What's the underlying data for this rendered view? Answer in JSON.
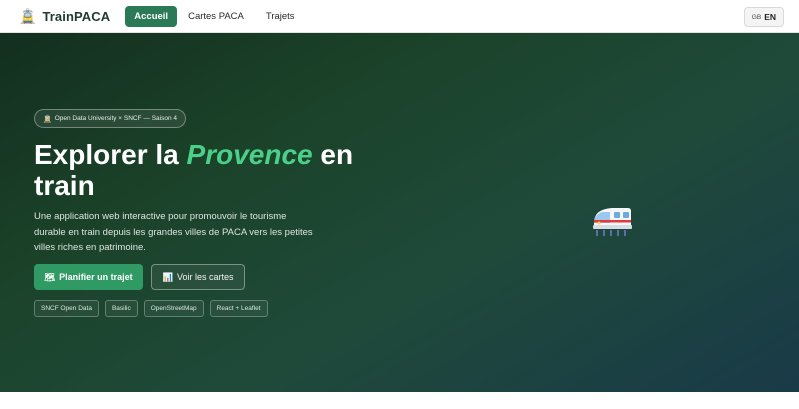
{
  "nav": {
    "brand_icon": "🚊",
    "brand": "TrainPACA",
    "links": [
      {
        "label": "Accueil",
        "active": true
      },
      {
        "label": "Cartes PACA",
        "active": false
      },
      {
        "label": "Trajets",
        "active": false
      }
    ],
    "lang_flag": "GB",
    "lang_code": "EN"
  },
  "hero": {
    "badge_icon": "🚊",
    "badge": "Open Data University × SNCF — Saison 4",
    "title_prefix": "Explorer la ",
    "title_highlight": "Provence",
    "title_suffix": " en train",
    "description": "Une application web interactive pour promouvoir le tourisme durable en train depuis les grandes villes de PACA vers les petites villes riches en patrimoine.",
    "primary_icon": "🗺",
    "primary_button": "Planifier un trajet",
    "secondary_icon": "📊",
    "secondary_button": "Voir les cartes",
    "tags": [
      "SNCF Open Data",
      "Basilic",
      "OpenStreetMap",
      "React + Leaflet"
    ],
    "illustration_icon": "train-icon"
  },
  "colors": {
    "accent": "#2a7a57",
    "primary_button": "#2f9a64",
    "highlight": "#4bd08a",
    "hero_start": "#132f1f",
    "hero_end": "#193a48"
  }
}
